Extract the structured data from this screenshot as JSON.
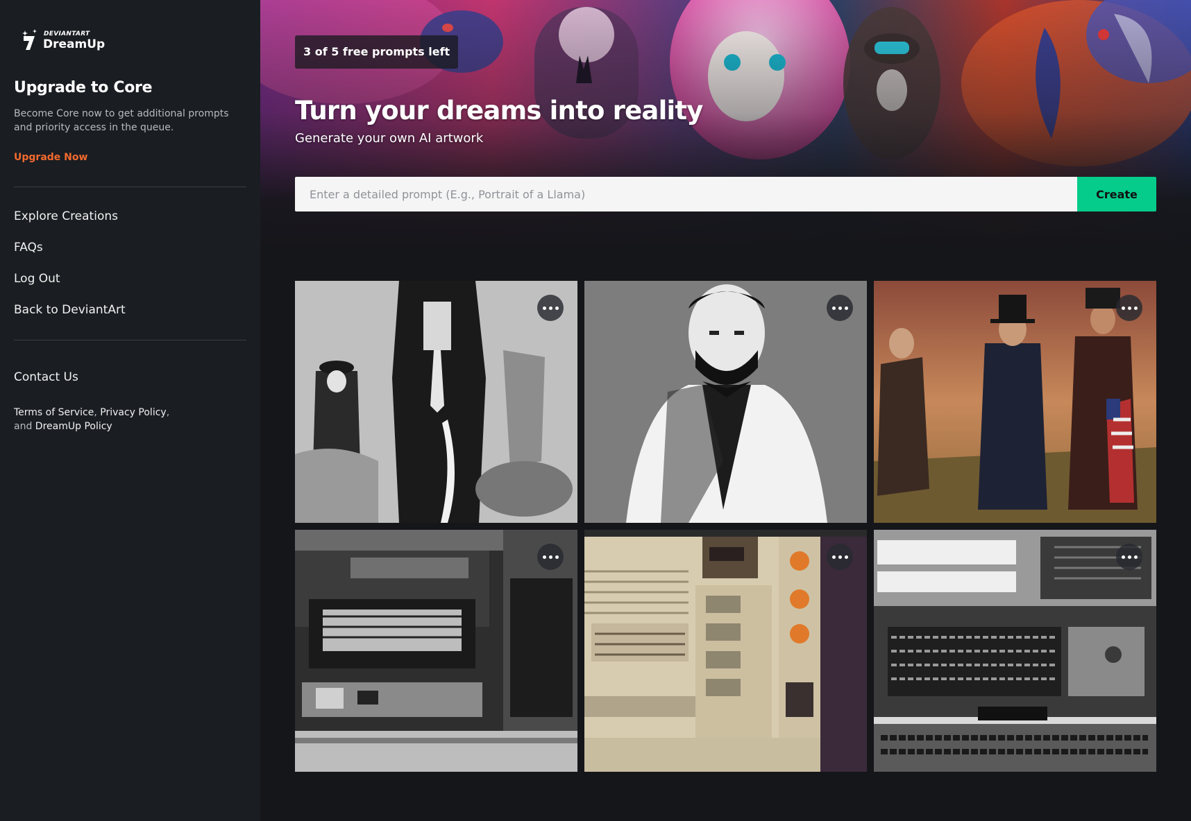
{
  "sidebar": {
    "logo": {
      "small": "DEVIANTART",
      "big": "DreamUp"
    },
    "upgrade": {
      "title": "Upgrade to Core",
      "description": "Become Core now to get additional prompts and priority access in the queue.",
      "link": "Upgrade Now"
    },
    "nav": [
      "Explore Creations",
      "FAQs",
      "Log Out",
      "Back to DeviantArt"
    ],
    "contact": "Contact Us",
    "legal": {
      "terms": "Terms of Service",
      "privacy": "Privacy Policy",
      "and": "and",
      "policy": "DreamUp Policy"
    }
  },
  "hero": {
    "badge": "3 of 5 free prompts left",
    "title": "Turn your dreams into reality",
    "subtitle": "Generate your own AI artwork",
    "prompt_placeholder": "Enter a detailed prompt (E.g., Portrait of a Llama)",
    "prompt_value": "",
    "create_label": "Create"
  },
  "gallery": {
    "items": [
      {
        "subject": "engraving-style portrait of a standing man with horses"
      },
      {
        "subject": "black and white portrait of Abraham Lincoln"
      },
      {
        "subject": "three men in top hats with an American flag"
      },
      {
        "subject": "vintage black and white computer terminal"
      },
      {
        "subject": "beige retro computer with orange dials"
      },
      {
        "subject": "monochrome mainframe computer console"
      }
    ]
  },
  "colors": {
    "accent": "#05cc8a",
    "upgrade_link": "#f26a2e",
    "sidebar_bg": "#1a1d22",
    "page_bg": "#15161a"
  }
}
